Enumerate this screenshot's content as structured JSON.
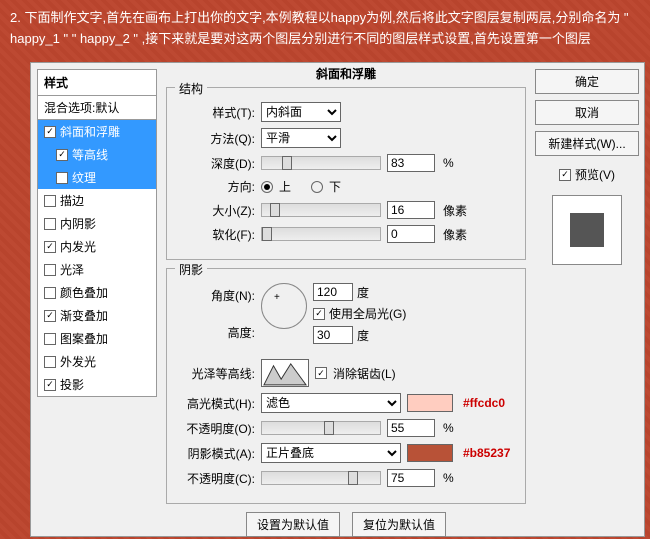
{
  "instruction": "2. 下面制作文字,首先在画布上打出你的文字,本例教程以happy为例,然后将此文字图层复制两层,分别命名为 \" happy_1 \" \" happy_2 \" ,接下来就是要对这两个图层分别进行不同的图层样式设置,首先设置第一个图层",
  "left": {
    "header": "样式",
    "blend": "混合选项:默认",
    "items": [
      {
        "label": "斜面和浮雕",
        "checked": true,
        "selected": true
      },
      {
        "label": "等高线",
        "checked": true,
        "selected": true,
        "sub": true
      },
      {
        "label": "纹理",
        "checked": false,
        "selected": true,
        "sub": true
      },
      {
        "label": "描边",
        "checked": false
      },
      {
        "label": "内阴影",
        "checked": false
      },
      {
        "label": "内发光",
        "checked": true
      },
      {
        "label": "光泽",
        "checked": false
      },
      {
        "label": "颜色叠加",
        "checked": false
      },
      {
        "label": "渐变叠加",
        "checked": true
      },
      {
        "label": "图案叠加",
        "checked": false
      },
      {
        "label": "外发光",
        "checked": false
      },
      {
        "label": "投影",
        "checked": true
      }
    ]
  },
  "title": "斜面和浮雕",
  "structure": {
    "legend": "结构",
    "style_lbl": "样式(T):",
    "style_val": "内斜面",
    "method_lbl": "方法(Q):",
    "method_val": "平滑",
    "depth_lbl": "深度(D):",
    "depth_val": "83",
    "depth_unit": "%",
    "dir_lbl": "方向:",
    "up": "上",
    "down": "下",
    "size_lbl": "大小(Z):",
    "size_val": "16",
    "size_unit": "像素",
    "soft_lbl": "软化(F):",
    "soft_val": "0",
    "soft_unit": "像素"
  },
  "shadow": {
    "legend": "阴影",
    "angle_lbl": "角度(N):",
    "angle_val": "120",
    "angle_unit": "度",
    "global": "使用全局光(G)",
    "alt_lbl": "高度:",
    "alt_val": "30",
    "alt_unit": "度",
    "gloss_lbl": "光泽等高线:",
    "aa": "消除锯齿(L)",
    "hi_mode_lbl": "高光模式(H):",
    "hi_mode_val": "滤色",
    "hi_color": "#ffcdc0",
    "hi_hex": "#ffcdc0",
    "hi_op_lbl": "不透明度(O):",
    "hi_op_val": "55",
    "hi_op_unit": "%",
    "sh_mode_lbl": "阴影模式(A):",
    "sh_mode_val": "正片叠底",
    "sh_color": "#b85237",
    "sh_hex": "#b85237",
    "sh_op_lbl": "不透明度(C):",
    "sh_op_val": "75",
    "sh_op_unit": "%"
  },
  "bottom": {
    "default": "设置为默认值",
    "reset": "复位为默认值"
  },
  "right": {
    "ok": "确定",
    "cancel": "取消",
    "new": "新建样式(W)...",
    "preview": "预览(V)"
  }
}
